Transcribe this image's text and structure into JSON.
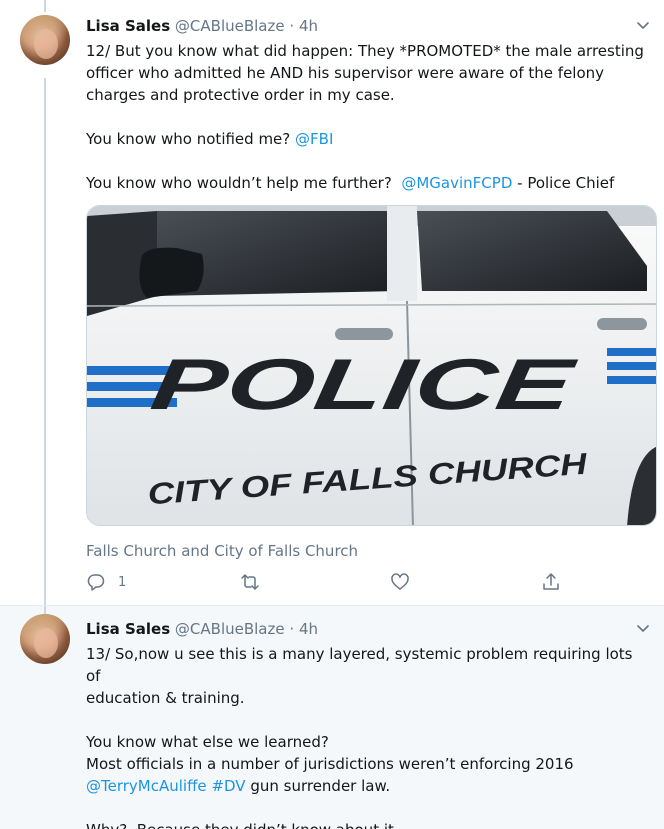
{
  "tweets": [
    {
      "name": "Lisa Sales",
      "handle": "@CABlueBlaze",
      "separator": "·",
      "time": "4h",
      "body_lines": [
        "12/ But you know what did happen: They *PROMOTED* the male arresting",
        "officer who admitted he AND his supervisor were aware of the felony",
        "charges and protective order in my case."
      ],
      "line_notified_prefix": "You know who notified me? ",
      "line_notified_link": "@FBI",
      "line_help_prefix": "You know who wouldn’t help me further?  ",
      "line_help_link": "@MGavinFCPD",
      "line_help_suffix": " - Police Chief",
      "media": {
        "word_police": "POLICE",
        "word_city": "CITY OF FALLS CHURCH"
      },
      "place": "Falls Church and City of Falls Church",
      "actions": {
        "reply_count": "1",
        "retweet_count": "",
        "like_count": ""
      }
    },
    {
      "name": "Lisa Sales",
      "handle": "@CABlueBlaze",
      "separator": "·",
      "time": "4h",
      "line1": "13/ So,now u see this is a many layered, systemic problem requiring lots of",
      "line2": "education & training.",
      "line3": "You know what else we learned?",
      "line4": "Most officials in a number of jurisdictions weren’t enforcing 2016",
      "line5_link1": "@TerryMcAuliffe",
      "line5_link2": "#DV",
      "line5_suffix": " gun surrender law.",
      "line6": "Why?  Because they didn’t know about it."
    }
  ],
  "colors": {
    "link": "#1b95e0",
    "secondary": "#657786",
    "police_blue": "#1f6fc8"
  },
  "icons": [
    "caret-down-icon",
    "reply-icon",
    "retweet-icon",
    "like-icon",
    "share-icon"
  ]
}
